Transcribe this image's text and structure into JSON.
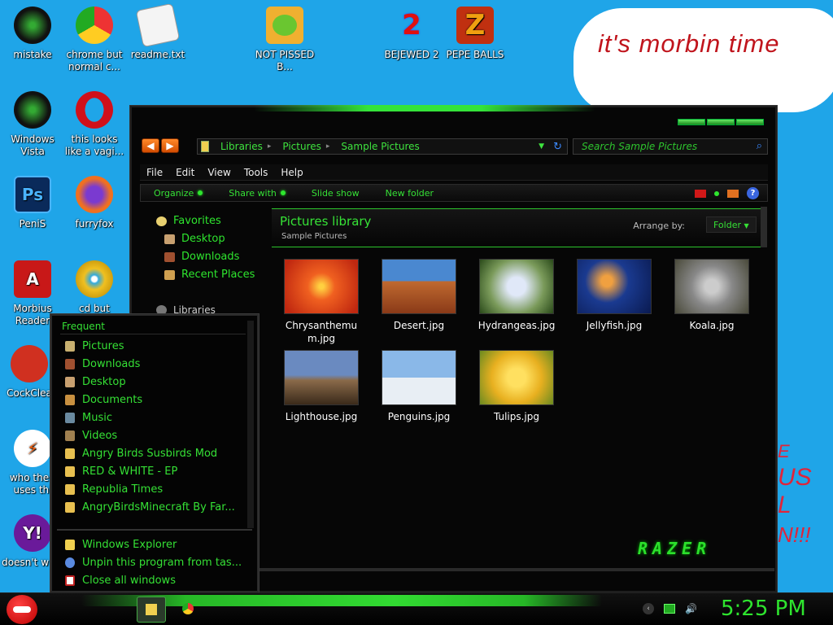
{
  "desktop": {
    "icons": [
      {
        "label": "mistake"
      },
      {
        "label": "chrome but normal c..."
      },
      {
        "label": "readme.txt"
      },
      {
        "label": "NOT PISSED B..."
      },
      {
        "label": "BEJEWED 2"
      },
      {
        "label": "PEPE BALLS"
      },
      {
        "label": "Windows Vista"
      },
      {
        "label": "this looks like a vagi..."
      },
      {
        "label": "PeniS"
      },
      {
        "label": "furryfox"
      },
      {
        "label": "Morbius Reader"
      },
      {
        "label": "cd but"
      },
      {
        "label": "CockClea"
      },
      {
        "label": "who the f uses thi"
      },
      {
        "label": "doesn't w lol"
      }
    ],
    "bubble_text": "it's morbin time",
    "scribble_lines": [
      "E",
      "US",
      "L",
      "N!!!"
    ]
  },
  "explorer": {
    "address": {
      "crumbs": [
        "Libraries",
        "Pictures",
        "Sample Pictures"
      ]
    },
    "search_placeholder": "Search Sample Pictures",
    "menu": [
      "File",
      "Edit",
      "View",
      "Tools",
      "Help"
    ],
    "toolbar": [
      "Organize",
      "Share with",
      "Slide show",
      "New folder"
    ],
    "nav": {
      "favorites": "Favorites",
      "items": [
        "Desktop",
        "Downloads",
        "Recent Places"
      ],
      "libraries": "Libraries"
    },
    "header": {
      "title": "Pictures library",
      "subtitle": "Sample Pictures",
      "arrange_label": "Arrange by:",
      "arrange_value": "Folder"
    },
    "files": [
      {
        "name": "Chrysanthemum.jpg",
        "color": "#e8501a"
      },
      {
        "name": "Desert.jpg",
        "color": "#b85a2a"
      },
      {
        "name": "Hydrangeas.jpg",
        "color": "#7a9a5a"
      },
      {
        "name": "Jellyfish.jpg",
        "color": "#1a4aa0"
      },
      {
        "name": "Koala.jpg",
        "color": "#8a8a80"
      },
      {
        "name": "Lighthouse.jpg",
        "color": "#6a7a9a"
      },
      {
        "name": "Penguins.jpg",
        "color": "#6a9ad0"
      },
      {
        "name": "Tulips.jpg",
        "color": "#e8b820"
      }
    ],
    "brand": "RAZER"
  },
  "jumplist": {
    "header": "Frequent",
    "items": [
      "Pictures",
      "Downloads",
      "Desktop",
      "Documents",
      "Music",
      "Videos",
      "Angry Birds Susbirds Mod",
      "RED & WHITE - EP",
      "Republia Times",
      "AngryBirdsMinecraft By Far..."
    ],
    "tasks": [
      "Windows Explorer",
      "Unpin this program from tas...",
      "Close all windows"
    ]
  },
  "taskbar": {
    "clock": "5:25 PM"
  }
}
